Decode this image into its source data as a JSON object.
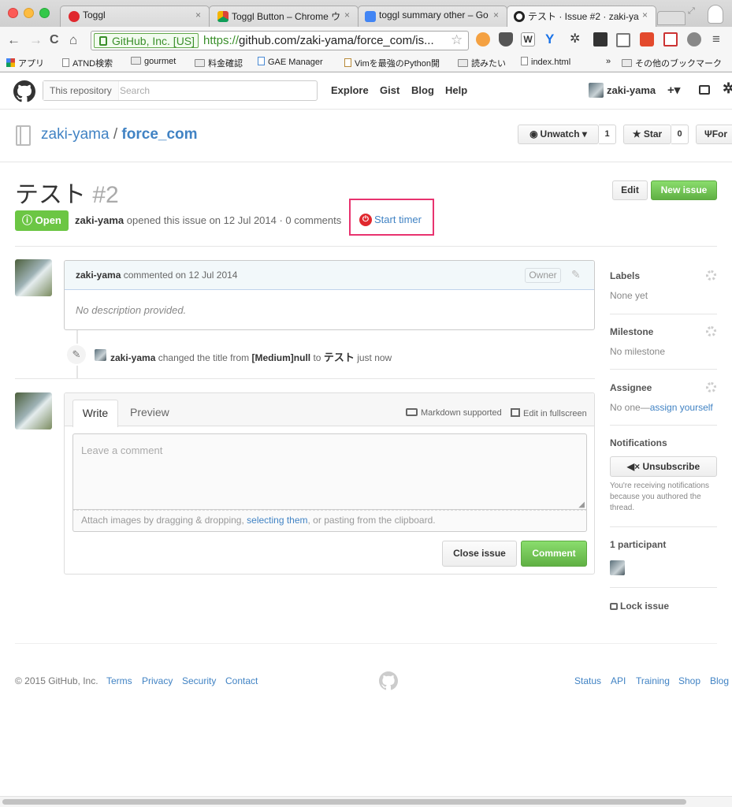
{
  "browser": {
    "tabs": [
      {
        "title": "Toggl"
      },
      {
        "title": "Toggl Button – Chrome ウ"
      },
      {
        "title": "toggl summary other – Go"
      },
      {
        "title": "テスト · Issue #2 · zaki-ya"
      }
    ],
    "ev_label": "GitHub, Inc. [US]",
    "url_scheme": "https://",
    "url_rest": "github.com/zaki-yama/force_com/is...",
    "bookmarks": [
      "アプリ",
      "ATND検索",
      "gourmet",
      "料金確認",
      "GAE Manager",
      "Vimを最強のPython開",
      "読みたい",
      "index.html",
      "»",
      "その他のブックマーク"
    ]
  },
  "gh_header": {
    "search_scope": "This repository",
    "search_placeholder": "Search",
    "nav": [
      "Explore",
      "Gist",
      "Blog",
      "Help"
    ],
    "user": "zaki-yama",
    "plus": "+▾"
  },
  "repo": {
    "owner": "zaki-yama",
    "slash": "/",
    "name": "force_com",
    "watch_label": "Unwatch ▾",
    "watch_count": "1",
    "star_label": "Star",
    "star_count": "0",
    "fork_label": "For"
  },
  "issue": {
    "title": "テスト",
    "number": "#2",
    "edit_label": "Edit",
    "new_issue_label": "New issue",
    "state": "Open",
    "author": "zaki-yama",
    "meta": "opened this issue on 12 Jul 2014 · 0 comments",
    "timer_label": "Start timer"
  },
  "comment": {
    "author": "zaki-yama",
    "meta": "commented on 12 Jul 2014",
    "owner_badge": "Owner",
    "body": "No description provided."
  },
  "event": {
    "actor": "zaki-yama",
    "text1": "changed the title from",
    "old_title": "[Medium]null",
    "text2": "to",
    "new_title": "テスト",
    "time": "just now"
  },
  "composer": {
    "tab_write": "Write",
    "tab_preview": "Preview",
    "markdown": "Markdown supported",
    "fullscreen": "Edit in fullscreen",
    "placeholder": "Leave a comment",
    "attach_pre": "Attach images by dragging & dropping,",
    "attach_link": "selecting them",
    "attach_post": ", or pasting from the clipboard.",
    "close_label": "Close issue",
    "comment_label": "Comment"
  },
  "sidebar": {
    "labels_head": "Labels",
    "labels_val": "None yet",
    "milestone_head": "Milestone",
    "milestone_val": "No milestone",
    "assignee_head": "Assignee",
    "assignee_val": "No one—",
    "assignee_link": "assign yourself",
    "notif_head": "Notifications",
    "unsubscribe": "Unsubscribe",
    "notif_note": "You're receiving notifications because you authored the thread.",
    "participants": "1 participant",
    "lock": "Lock issue"
  },
  "footer": {
    "copyright": "© 2015 GitHub, Inc.",
    "left_links": [
      "Terms",
      "Privacy",
      "Security",
      "Contact"
    ],
    "right_links": [
      "Status",
      "API",
      "Training",
      "Shop",
      "Blog"
    ]
  },
  "colors": {
    "link": "#4183c4",
    "green": "#6cc644",
    "highlight": "#e8336f",
    "toggl": "#e0282e"
  }
}
